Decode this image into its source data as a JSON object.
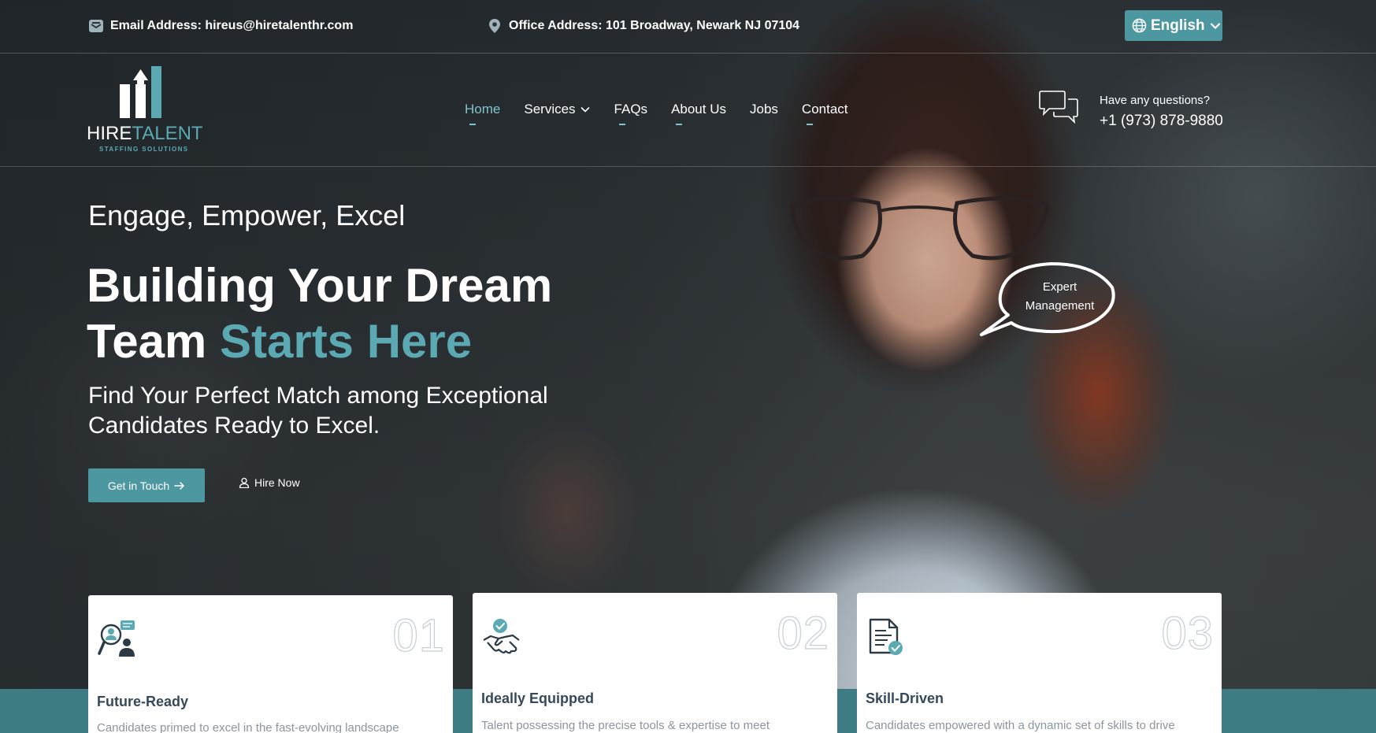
{
  "topbar": {
    "email": "Email Address: hireus@hiretalenthr.com",
    "address": "Office Address: 101 Broadway, Newark NJ 07104",
    "language": "English"
  },
  "logo": {
    "hire": "HIRE",
    "talent": "TALENT",
    "sub": "STAFFING SOLUTIONS"
  },
  "nav": {
    "items": [
      {
        "label": "Home"
      },
      {
        "label": "Services"
      },
      {
        "label": "FAQs"
      },
      {
        "label": "About Us"
      },
      {
        "label": "Jobs"
      },
      {
        "label": "Contact"
      }
    ]
  },
  "contact": {
    "question": "Have any questions?",
    "phone": "+1 (973) 878-9880"
  },
  "hero": {
    "tagline": "Engage, Empower, Excel",
    "headline_line1": "Building Your Dream",
    "headline_line2_plain": "Team ",
    "headline_line2_accent": "Starts Here",
    "subtext": "Find Your Perfect Match among Exceptional Candidates Ready to Excel.",
    "primary_button": "Get in Touch",
    "secondary_button": "Hire Now",
    "bubble": "Expert Management"
  },
  "cards": [
    {
      "number": "01",
      "title": "Future-Ready",
      "desc": "Candidates primed to excel in the fast-evolving landscape"
    },
    {
      "number": "02",
      "title": "Ideally Equipped",
      "desc": "Talent possessing the precise tools & expertise to meet"
    },
    {
      "number": "03",
      "title": "Skill-Driven",
      "desc": "Candidates empowered with a dynamic set of skills to drive"
    }
  ],
  "colors": {
    "accent": "#4d97a1",
    "accent_light": "#5aa9b3",
    "band": "#3e7c83"
  }
}
